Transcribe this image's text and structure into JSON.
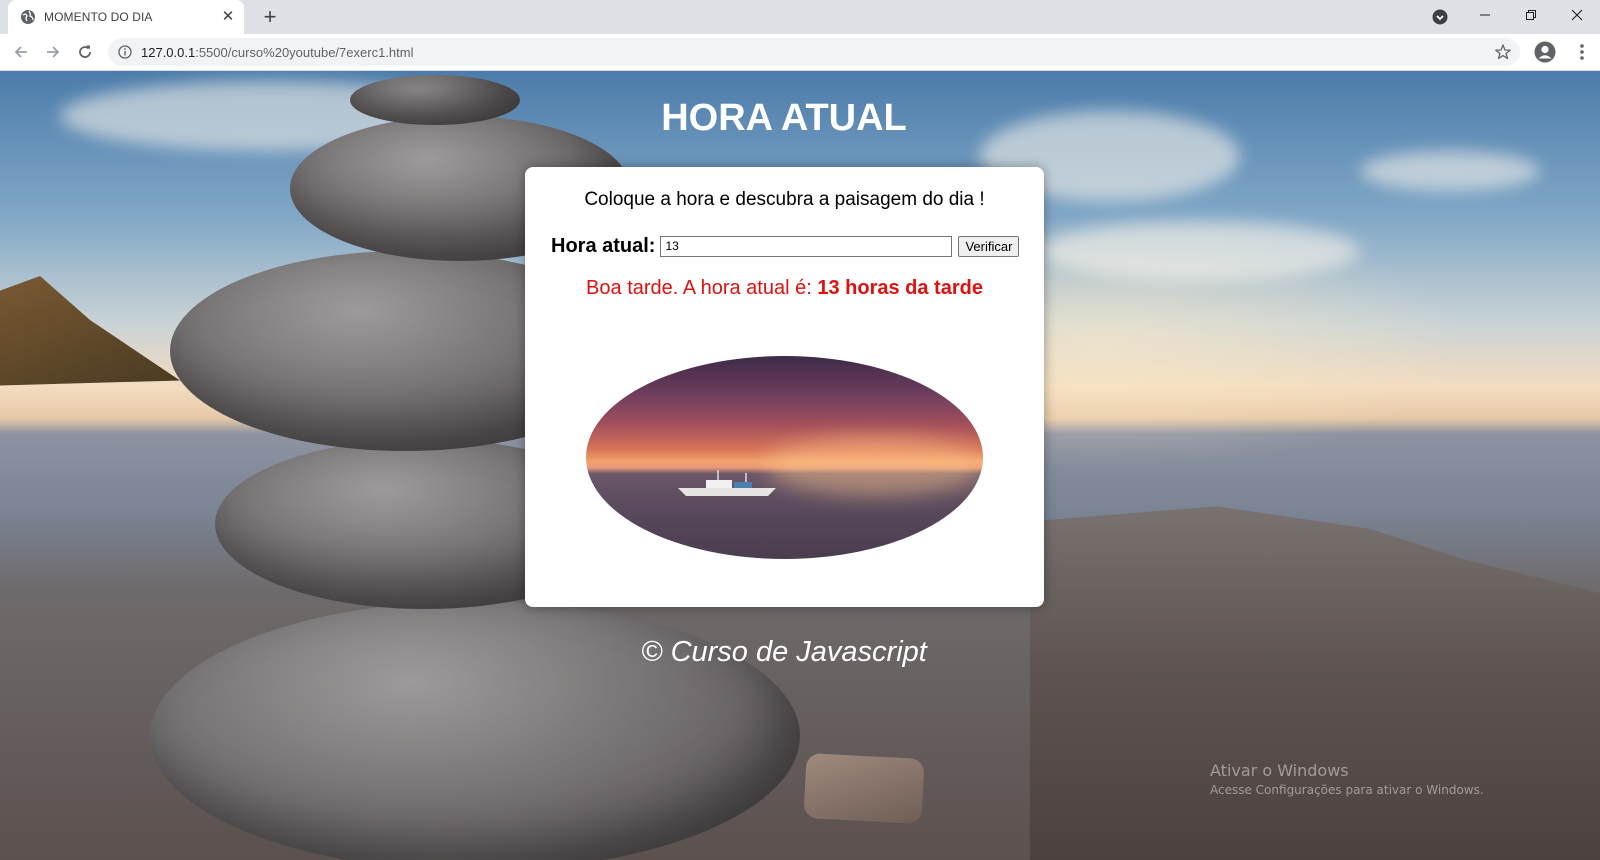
{
  "browser": {
    "tab": {
      "title": "MOMENTO DO DIA"
    },
    "address": {
      "host": "127.0.0.1",
      "path": ":5500/curso%20youtube/7exerc1.html"
    },
    "icons": [
      "globe-icon",
      "close-icon",
      "plus-icon",
      "tab-search-icon",
      "minimize-icon",
      "restore-icon",
      "window-close-icon",
      "back-icon",
      "forward-icon",
      "reload-icon",
      "info-icon",
      "star-icon",
      "profile-icon",
      "menu-icon"
    ]
  },
  "page": {
    "heading": "HORA ATUAL",
    "intro": "Coloque a hora e descubra a paisagem do dia !",
    "form": {
      "label": "Hora atual:",
      "hour_value": "13",
      "button_label": "Verificar"
    },
    "result": {
      "prefix": "Boa tarde. A hora atual é: ",
      "emphasis": "13 horas da tarde"
    },
    "footer": "© Curso de Javascript"
  },
  "watermark": {
    "title": "Ativar o Windows",
    "subtitle": "Acesse Configurações para ativar o Windows."
  },
  "colors": {
    "result_text": "#e01010",
    "card_background": "#ffffff",
    "heading_text": "#ffffff"
  }
}
